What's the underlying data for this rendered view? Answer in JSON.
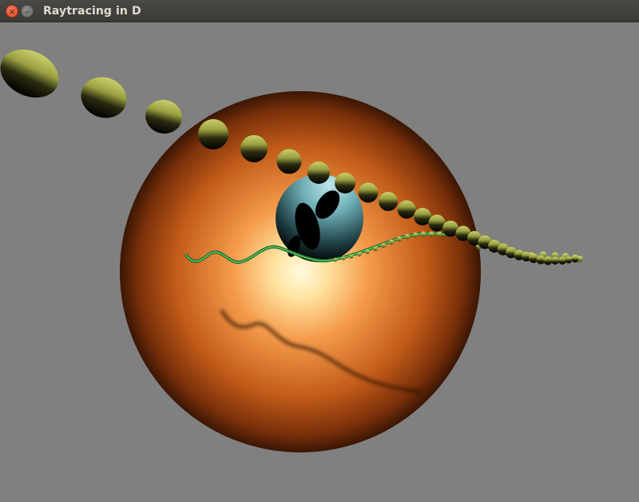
{
  "window": {
    "title": "Raytracing in D"
  },
  "icons": {
    "close": "close-icon",
    "minimize": "minimize-icon"
  },
  "colors": {
    "background": "#808080",
    "large_sphere": "#e8822a",
    "center_sphere": "#6fb0b8",
    "small_spheres": "#c8cf62",
    "strand": "#3da844"
  }
}
